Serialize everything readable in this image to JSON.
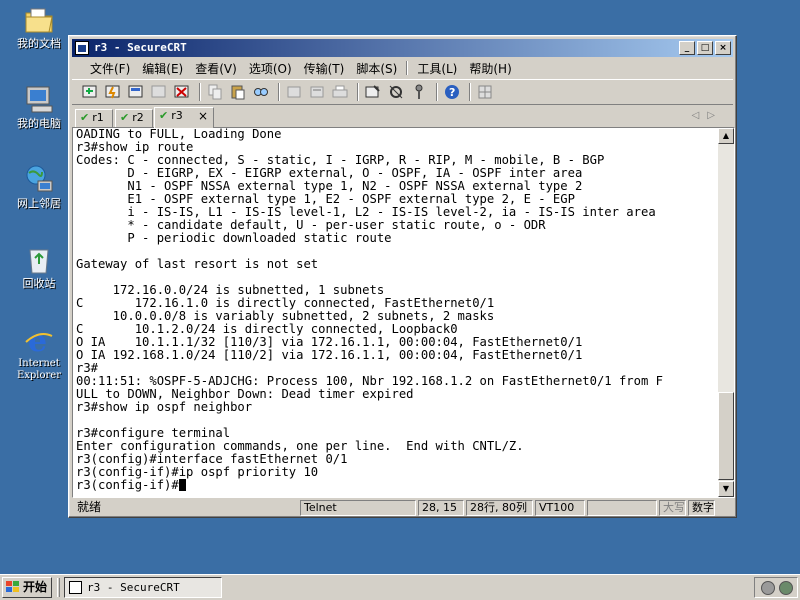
{
  "desktop": {
    "icons": [
      {
        "label": "我的文档",
        "icon": "my-documents-icon"
      },
      {
        "label": "我的电脑",
        "icon": "my-computer-icon"
      },
      {
        "label": "网上邻居",
        "icon": "network-places-icon"
      },
      {
        "label": "回收站",
        "icon": "recycle-bin-icon"
      },
      {
        "label": "Internet\nExplorer",
        "icon": "internet-explorer-icon"
      }
    ]
  },
  "window": {
    "title": "r3 - SecureCRT",
    "controls": {
      "minimize": "_",
      "maximize": "□",
      "close": "×"
    },
    "menu": [
      "文件(F)",
      "编辑(E)",
      "查看(V)",
      "选项(O)",
      "传输(T)",
      "脚本(S)",
      "工具(L)",
      "帮助(H)"
    ],
    "tabs": [
      {
        "label": "r1",
        "active": false
      },
      {
        "label": "r2",
        "active": false
      },
      {
        "label": "r3",
        "active": true,
        "close": "×"
      }
    ],
    "terminal_lines": [
      "OADING to FULL, Loading Done",
      "r3#show ip route",
      "Codes: C - connected, S - static, I - IGRP, R - RIP, M - mobile, B - BGP",
      "       D - EIGRP, EX - EIGRP external, O - OSPF, IA - OSPF inter area",
      "       N1 - OSPF NSSA external type 1, N2 - OSPF NSSA external type 2",
      "       E1 - OSPF external type 1, E2 - OSPF external type 2, E - EGP",
      "       i - IS-IS, L1 - IS-IS level-1, L2 - IS-IS level-2, ia - IS-IS inter area",
      "       * - candidate default, U - per-user static route, o - ODR",
      "       P - periodic downloaded static route",
      "",
      "Gateway of last resort is not set",
      "",
      "     172.16.0.0/24 is subnetted, 1 subnets",
      "C       172.16.1.0 is directly connected, FastEthernet0/1",
      "     10.0.0.0/8 is variably subnetted, 2 subnets, 2 masks",
      "C       10.1.2.0/24 is directly connected, Loopback0",
      "O IA    10.1.1.1/32 [110/3] via 172.16.1.1, 00:00:04, FastEthernet0/1",
      "O IA 192.168.1.0/24 [110/2] via 172.16.1.1, 00:00:04, FastEthernet0/1",
      "r3#",
      "00:11:51: %OSPF-5-ADJCHG: Process 100, Nbr 192.168.1.2 on FastEthernet0/1 from F",
      "ULL to DOWN, Neighbor Down: Dead timer expired",
      "r3#show ip ospf neighbor",
      "",
      "r3#configure terminal",
      "Enter configuration commands, one per line.  End with CNTL/Z.",
      "r3(config)#interface fastEthernet 0/1",
      "r3(config-if)#ip ospf priority 10",
      "r3(config-if)#"
    ],
    "status": {
      "ready": "就绪",
      "protocol": "Telnet",
      "cursor_pos": "28,  15",
      "size": "28行, 80列",
      "emulation": "VT100",
      "caps": "大写",
      "num": "数字"
    }
  },
  "taskbar": {
    "start": "开始",
    "task_title": "r3 - SecureCRT"
  },
  "colors": {
    "desktop": "#3a6ea5",
    "title_start": "#0a246a",
    "title_end": "#a6caf0",
    "chrome": "#d4d0c8"
  }
}
